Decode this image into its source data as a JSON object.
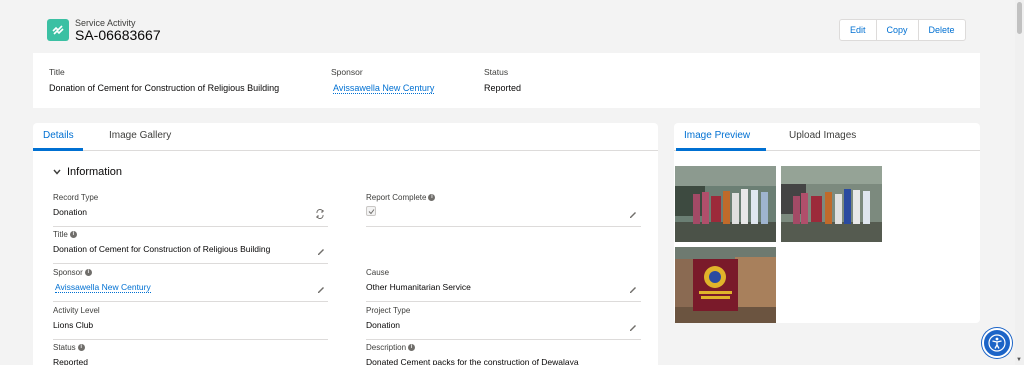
{
  "record": {
    "object_type": "Service Activity",
    "name": "SA-06683667",
    "actions": [
      "Edit",
      "Copy",
      "Delete"
    ]
  },
  "highlights": {
    "title_label": "Title",
    "title_value": "Donation of Cement for Construction of Religious Building",
    "sponsor_label": "Sponsor",
    "sponsor_value": "Avissawella New Century",
    "status_label": "Status",
    "status_value": "Reported"
  },
  "main_tabs": [
    "Details",
    "Image Gallery"
  ],
  "section_title": "Information",
  "fields": {
    "record_type": {
      "label": "Record Type",
      "value": "Donation"
    },
    "report_complete": {
      "label": "Report Complete"
    },
    "title": {
      "label": "Title",
      "value": "Donation of Cement for Construction of Religious Building"
    },
    "sponsor": {
      "label": "Sponsor",
      "value": "Avissawella New Century"
    },
    "cause": {
      "label": "Cause",
      "value": "Other Humanitarian Service"
    },
    "activity_level": {
      "label": "Activity Level",
      "value": "Lions Club"
    },
    "project_type": {
      "label": "Project Type",
      "value": "Donation"
    },
    "status": {
      "label": "Status",
      "value": "Reported"
    },
    "description": {
      "label": "Description",
      "value": "Donated Cement packs for the construction of Dewalaya"
    }
  },
  "side_tabs": [
    "Image Preview",
    "Upload Images"
  ],
  "colors": {
    "accent": "#0070d2",
    "object_icon": "#3bc0a3",
    "a11y": "#1c64c7"
  }
}
